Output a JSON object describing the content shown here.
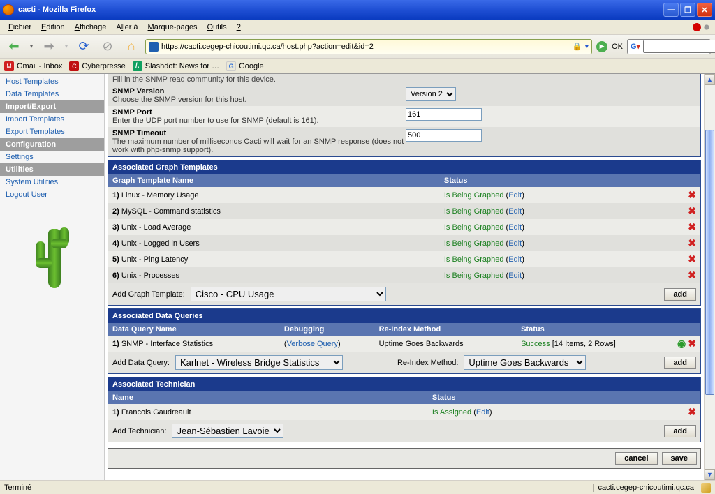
{
  "window": {
    "title": "cacti - Mozilla Firefox"
  },
  "menu": {
    "items": [
      "Fichier",
      "Edition",
      "Affichage",
      "Aller à",
      "Marque-pages",
      "Outils",
      "?"
    ]
  },
  "url": "https://cacti.cegep-chicoutimi.qc.ca/host.php?action=edit&id=2",
  "nav_ok": "OK",
  "bookmarks": [
    {
      "label": "Gmail - Inbox"
    },
    {
      "label": "Cyberpresse"
    },
    {
      "label": "Slashdot: News for …"
    },
    {
      "label": "Google"
    }
  ],
  "sidebar": {
    "items": [
      {
        "label": "Host Templates",
        "head": false
      },
      {
        "label": "Data Templates",
        "head": false
      },
      {
        "label": "Import/Export",
        "head": true
      },
      {
        "label": "Import Templates",
        "head": false
      },
      {
        "label": "Export Templates",
        "head": false
      },
      {
        "label": "Configuration",
        "head": true
      },
      {
        "label": "Settings",
        "head": false
      },
      {
        "label": "Utilities",
        "head": true
      },
      {
        "label": "System Utilities",
        "head": false
      },
      {
        "label": "Logout User",
        "head": false
      }
    ]
  },
  "form": {
    "community_desc_partial": "Fill in the SNMP read community for this device.",
    "snmp_version": {
      "title": "SNMP Version",
      "desc": "Choose the SNMP version for this host.",
      "value": "Version 2"
    },
    "snmp_port": {
      "title": "SNMP Port",
      "desc": "Enter the UDP port number to use for SNMP (default is 161).",
      "value": "161"
    },
    "snmp_timeout": {
      "title": "SNMP Timeout",
      "desc": "The maximum number of milliseconds Cacti will wait for an SNMP response (does not work with php-snmp support).",
      "value": "500"
    }
  },
  "graph_templates": {
    "header": "Associated Graph Templates",
    "col_name": "Graph Template Name",
    "col_status": "Status",
    "rows": [
      {
        "n": "1)",
        "name": "Linux - Memory Usage",
        "status": "Is Being Graphed",
        "edit": "Edit"
      },
      {
        "n": "2)",
        "name": "MySQL - Command statistics",
        "status": "Is Being Graphed",
        "edit": "Edit"
      },
      {
        "n": "3)",
        "name": "Unix - Load Average",
        "status": "Is Being Graphed",
        "edit": "Edit"
      },
      {
        "n": "4)",
        "name": "Unix - Logged in Users",
        "status": "Is Being Graphed",
        "edit": "Edit"
      },
      {
        "n": "5)",
        "name": "Unix - Ping Latency",
        "status": "Is Being Graphed",
        "edit": "Edit"
      },
      {
        "n": "6)",
        "name": "Unix - Processes",
        "status": "Is Being Graphed",
        "edit": "Edit"
      }
    ],
    "add_label": "Add Graph Template:",
    "add_value": "Cisco - CPU Usage",
    "add_btn": "add"
  },
  "data_queries": {
    "header": "Associated Data Queries",
    "col_name": "Data Query Name",
    "col_debug": "Debugging",
    "col_reindex": "Re-Index Method",
    "col_status": "Status",
    "rows": [
      {
        "n": "1)",
        "name": "SNMP - Interface Statistics",
        "debug": "Verbose Query",
        "reindex": "Uptime Goes Backwards",
        "status": "Success",
        "status_extra": " [14 Items, 2 Rows]"
      }
    ],
    "add_label": "Add Data Query:",
    "add_value": "Karlnet - Wireless Bridge Statistics",
    "reindex_label": "Re-Index Method:",
    "reindex_value": "Uptime Goes Backwards",
    "add_btn": "add"
  },
  "technician": {
    "header": "Associated Technician",
    "col_name": "Name",
    "col_status": "Status",
    "rows": [
      {
        "n": "1)",
        "name": "Francois Gaudreault",
        "status": "Is Assigned",
        "edit": "Edit"
      }
    ],
    "add_label": "Add Technician:",
    "add_value": "Jean-Sébastien Lavoie",
    "add_btn": "add"
  },
  "buttons": {
    "cancel": "cancel",
    "save": "save"
  },
  "status": {
    "left": "Terminé",
    "domain": "cacti.cegep-chicoutimi.qc.ca"
  }
}
